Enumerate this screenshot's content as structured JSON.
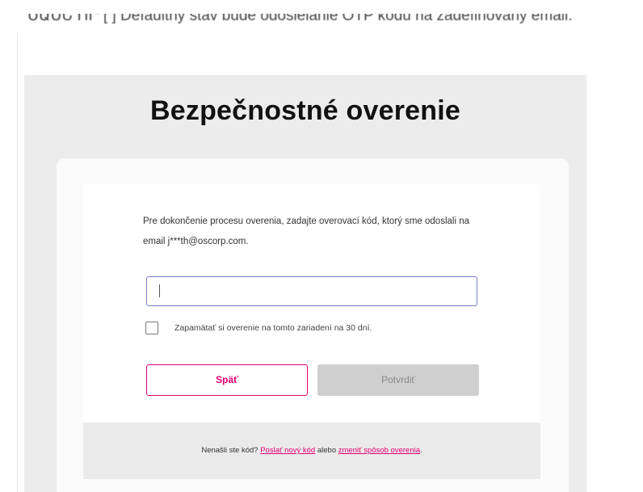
{
  "top_note": "ՍԱՍԵ ՈՐ [ ] Defaultný stav bude odosielanie OTP kódu na zadefinovaný email.",
  "heading": "Bezpečnostné overenie",
  "description": "Pre dokončenie procesu overenia, zadajte overovací kód, ktorý sme odoslali na email j***th@oscorp.com.",
  "code_input": {
    "value": "",
    "placeholder": ""
  },
  "remember": {
    "label": "Zapamätať si overenie na tomto zariadení na 30 dní.",
    "checked": false
  },
  "buttons": {
    "back_label": "Späť",
    "confirm_label": "Potvrdiť"
  },
  "footer": {
    "prefix": "Nenašli ste kód?",
    "resend_link": "Poslať nový kód",
    "middle": "alebo",
    "change_link": "zmeniť spôsob overenia",
    "suffix": "."
  },
  "colors": {
    "accent": "#e20074",
    "input_focus_border": "#7a7ec8",
    "disabled_button": "#cfcfcf"
  }
}
